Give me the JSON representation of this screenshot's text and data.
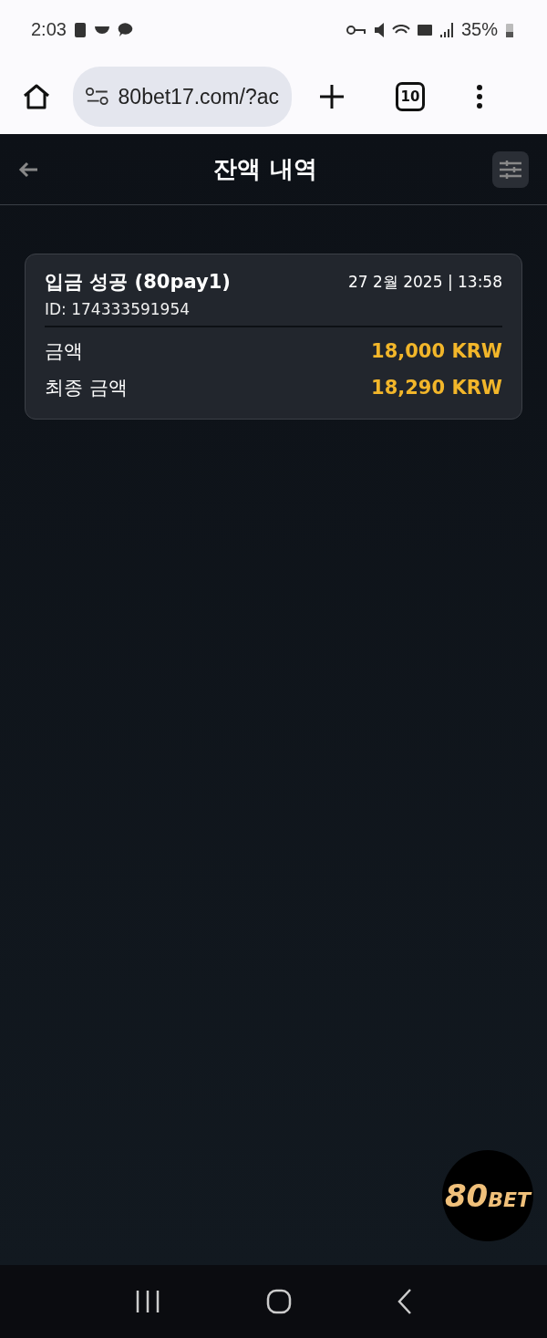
{
  "status_bar": {
    "time": "2:03",
    "battery": "35%"
  },
  "browser": {
    "url": "80bet17.com/?ac",
    "tab_count": "10"
  },
  "header": {
    "title": "잔액 내역"
  },
  "transactions": [
    {
      "title": "입금 성공 (80pay1)",
      "datetime": "27 2월 2025 | 13:58",
      "id": "ID: 174333591954",
      "rows": [
        {
          "label": "금액",
          "value": "18,000 KRW"
        },
        {
          "label": "최종 금액",
          "value": "18,290 KRW"
        }
      ]
    }
  ],
  "logo": {
    "number": "80",
    "word": "BET"
  }
}
